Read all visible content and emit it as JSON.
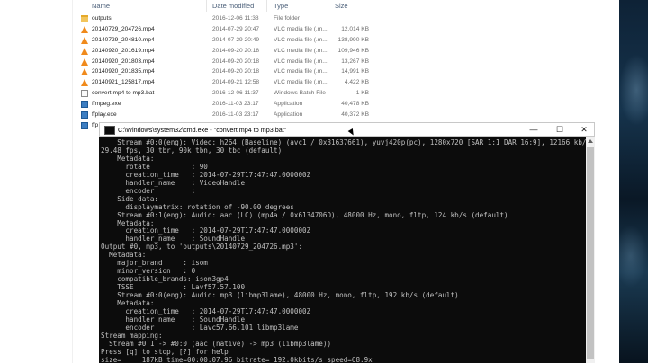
{
  "explorer": {
    "columns": {
      "name": "Name",
      "date": "Date modified",
      "type": "Type",
      "size": "Size"
    },
    "files": [
      {
        "icon": "folder-icon",
        "name": "outputs",
        "date": "2016-12-06 11:38",
        "type": "File folder",
        "size": ""
      },
      {
        "icon": "vlc-icon",
        "name": "20140729_204726.mp4",
        "date": "2014-07-29 20:47",
        "type": "VLC media file (.m...",
        "size": "12,014 KB"
      },
      {
        "icon": "vlc-icon",
        "name": "20140729_204810.mp4",
        "date": "2014-07-29 20:49",
        "type": "VLC media file (.m...",
        "size": "138,990 KB"
      },
      {
        "icon": "vlc-icon",
        "name": "20140920_201619.mp4",
        "date": "2014-09-20 20:18",
        "type": "VLC media file (.m...",
        "size": "109,946 KB"
      },
      {
        "icon": "vlc-icon",
        "name": "20140920_201803.mp4",
        "date": "2014-09-20 20:18",
        "type": "VLC media file (.m...",
        "size": "13,267 KB"
      },
      {
        "icon": "vlc-icon",
        "name": "20140920_201835.mp4",
        "date": "2014-09-20 20:18",
        "type": "VLC media file (.m...",
        "size": "14,991 KB"
      },
      {
        "icon": "vlc-icon",
        "name": "20140921_125817.mp4",
        "date": "2014-09-21 12:58",
        "type": "VLC media file (.m...",
        "size": "4,422 KB"
      },
      {
        "icon": "bat-icon",
        "name": "convert mp4 to mp3.bat",
        "date": "2016-12-06 11:37",
        "type": "Windows Batch File",
        "size": "1 KB"
      },
      {
        "icon": "exe-icon",
        "name": "ffmpeg.exe",
        "date": "2016-11-03 23:17",
        "type": "Application",
        "size": "40,478 KB"
      },
      {
        "icon": "exe-icon",
        "name": "ffplay.exe",
        "date": "2016-11-03 23:17",
        "type": "Application",
        "size": "40,372 KB"
      },
      {
        "icon": "exe-icon",
        "name": "ffp",
        "date": "",
        "type": "",
        "size": ""
      }
    ]
  },
  "cmd": {
    "title": "C:\\Windows\\system32\\cmd.exe - \"convert mp4 to mp3.bat\"",
    "buttons": {
      "minimize": "—",
      "maximize": "☐",
      "close": "✕"
    },
    "lines": [
      "    Stream #0:0(eng): Video: h264 (Baseline) (avc1 / 0x31637661), yuvj420p(pc), 1280x720 [SAR 1:1 DAR 16:9], 12166 kb/s,",
      "29.48 fps, 30 tbr, 90k tbn, 30 tbc (default)",
      "    Metadata:",
      "      rotate          : 90",
      "      creation_time   : 2014-07-29T17:47:47.000000Z",
      "      handler_name    : VideoHandle",
      "      encoder         :",
      "    Side data:",
      "      displaymatrix: rotation of -90.00 degrees",
      "    Stream #0:1(eng): Audio: aac (LC) (mp4a / 0x6134706D), 48000 Hz, mono, fltp, 124 kb/s (default)",
      "    Metadata:",
      "      creation_time   : 2014-07-29T17:47:47.000000Z",
      "      handler_name    : SoundHandle",
      "Output #0, mp3, to 'outputs\\20140729_204726.mp3':",
      "  Metadata:",
      "    major_brand     : isom",
      "    minor_version   : 0",
      "    compatible_brands: isom3gp4",
      "    TSSE            : Lavf57.57.100",
      "    Stream #0:0(eng): Audio: mp3 (libmp3lame), 48000 Hz, mono, fltp, 192 kb/s (default)",
      "    Metadata:",
      "      creation_time   : 2014-07-29T17:47:47.000000Z",
      "      handler_name    : SoundHandle",
      "      encoder         : Lavc57.66.101 libmp3lame",
      "Stream mapping:",
      "  Stream #0:1 -> #0:0 (aac (native) -> mp3 (libmp3lame))",
      "Press [q] to stop, [?] for help",
      "size=     187kB time=00:00:07.96 bitrate= 192.0kbits/s speed=68.9x"
    ]
  }
}
